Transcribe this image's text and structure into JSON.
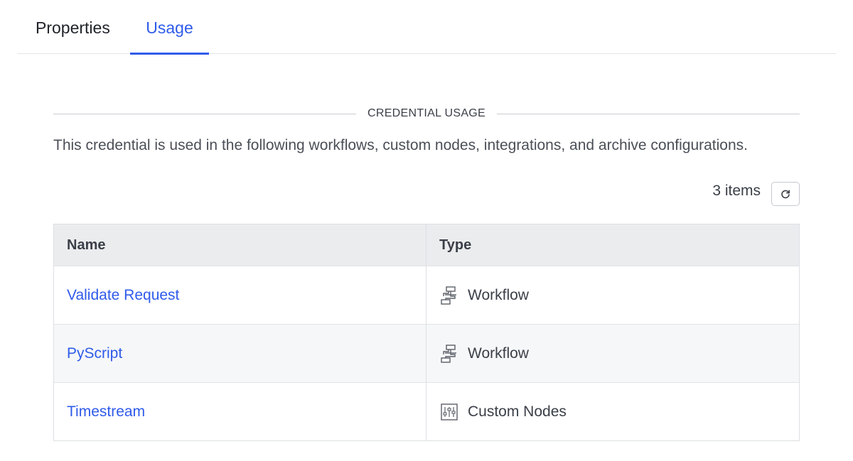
{
  "tabs": [
    {
      "label": "Properties",
      "active": false
    },
    {
      "label": "Usage",
      "active": true
    }
  ],
  "section": {
    "title": "CREDENTIAL USAGE",
    "description": "This credential is used in the following workflows, custom nodes, integrations, and archive configurations."
  },
  "toolbar": {
    "items_count": "3 items",
    "refresh_icon": "refresh-icon"
  },
  "table": {
    "columns": [
      "Name",
      "Type"
    ],
    "rows": [
      {
        "name": "Validate Request",
        "type": "Workflow",
        "icon": "workflow-icon"
      },
      {
        "name": "PyScript",
        "type": "Workflow",
        "icon": "workflow-icon"
      },
      {
        "name": "Timestream",
        "type": "Custom Nodes",
        "icon": "custom-nodes-icon"
      }
    ]
  },
  "colors": {
    "accent": "#2f5bea",
    "header_bg": "#ebecee",
    "text": "#3a3f47"
  }
}
